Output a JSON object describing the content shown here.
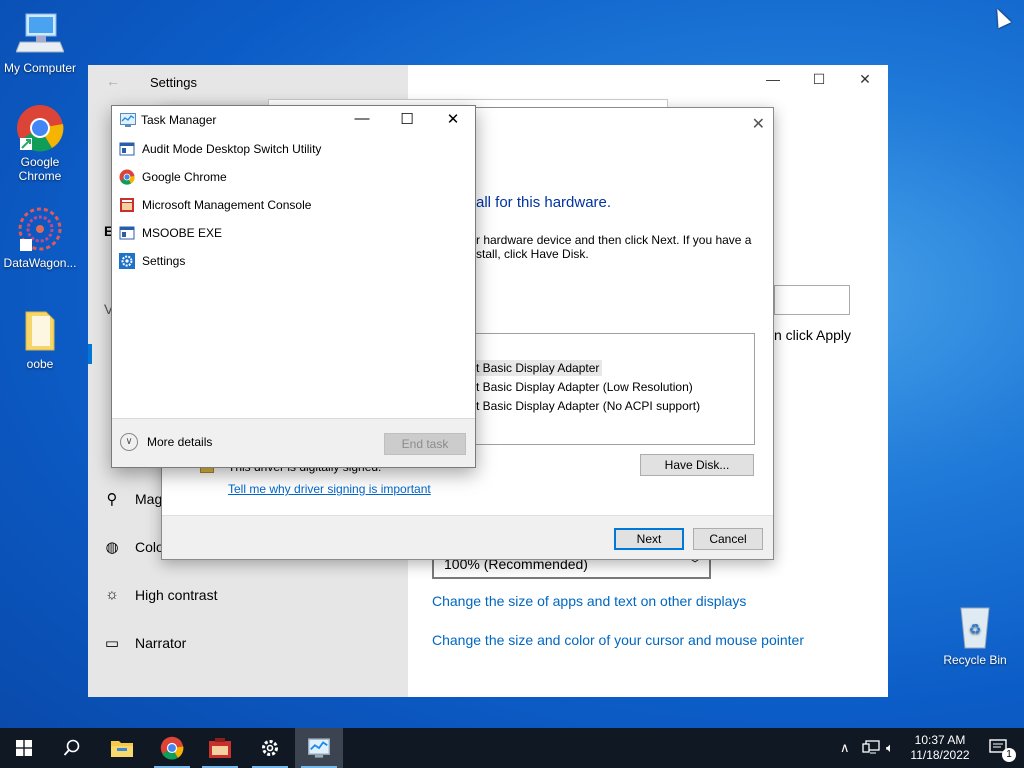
{
  "desktop": {
    "icons": [
      {
        "label": "My Computer"
      },
      {
        "label": "Google Chrome"
      },
      {
        "label": "DataWagon..."
      },
      {
        "label": "oobe"
      },
      {
        "label": "Recycle Bin"
      }
    ]
  },
  "settings": {
    "title": "Settings",
    "sidebar": {
      "fragments": [
        "E",
        "V"
      ],
      "items": [
        {
          "label": "Mag",
          "icon": "magnifier-icon"
        },
        {
          "label": "Colo",
          "icon": "color-filters-icon"
        },
        {
          "label": "High contrast",
          "icon": "high-contrast-icon"
        },
        {
          "label": "Narrator",
          "icon": "narrator-icon"
        }
      ]
    },
    "main": {
      "right_text": "n click Apply",
      "scale_value": "100% (Recommended)",
      "links": [
        "Change the size of apps and text on other displays",
        "Change the size and color of your cursor and mouse pointer"
      ]
    }
  },
  "driver_dialog": {
    "heading": "all for this hardware.",
    "instructions": "r hardware device and then click Next. If you have a\nstall, click Have Disk.",
    "models": [
      "t Basic Display Adapter",
      "t Basic Display Adapter (Low Resolution)",
      "t Basic Display Adapter (No ACPI support)"
    ],
    "signed_text": "This driver is digitally signed.",
    "signing_link": "Tell me why driver signing is important",
    "have_disk": "Have Disk...",
    "next": "Next",
    "cancel": "Cancel"
  },
  "task_manager": {
    "title": "Task Manager",
    "apps": [
      {
        "label": "Audit Mode Desktop Switch Utility",
        "icon": "audit-mode-icon"
      },
      {
        "label": "Google Chrome",
        "icon": "chrome-icon"
      },
      {
        "label": "Microsoft Management Console",
        "icon": "mmc-icon"
      },
      {
        "label": "MSOOBE EXE",
        "icon": "msoobe-icon"
      },
      {
        "label": "Settings",
        "icon": "settings-gear-icon"
      }
    ],
    "more_details": "More details",
    "end_task": "End task"
  },
  "taskbar": {
    "time": "10:37 AM",
    "date": "11/18/2022",
    "notification_count": "1"
  }
}
